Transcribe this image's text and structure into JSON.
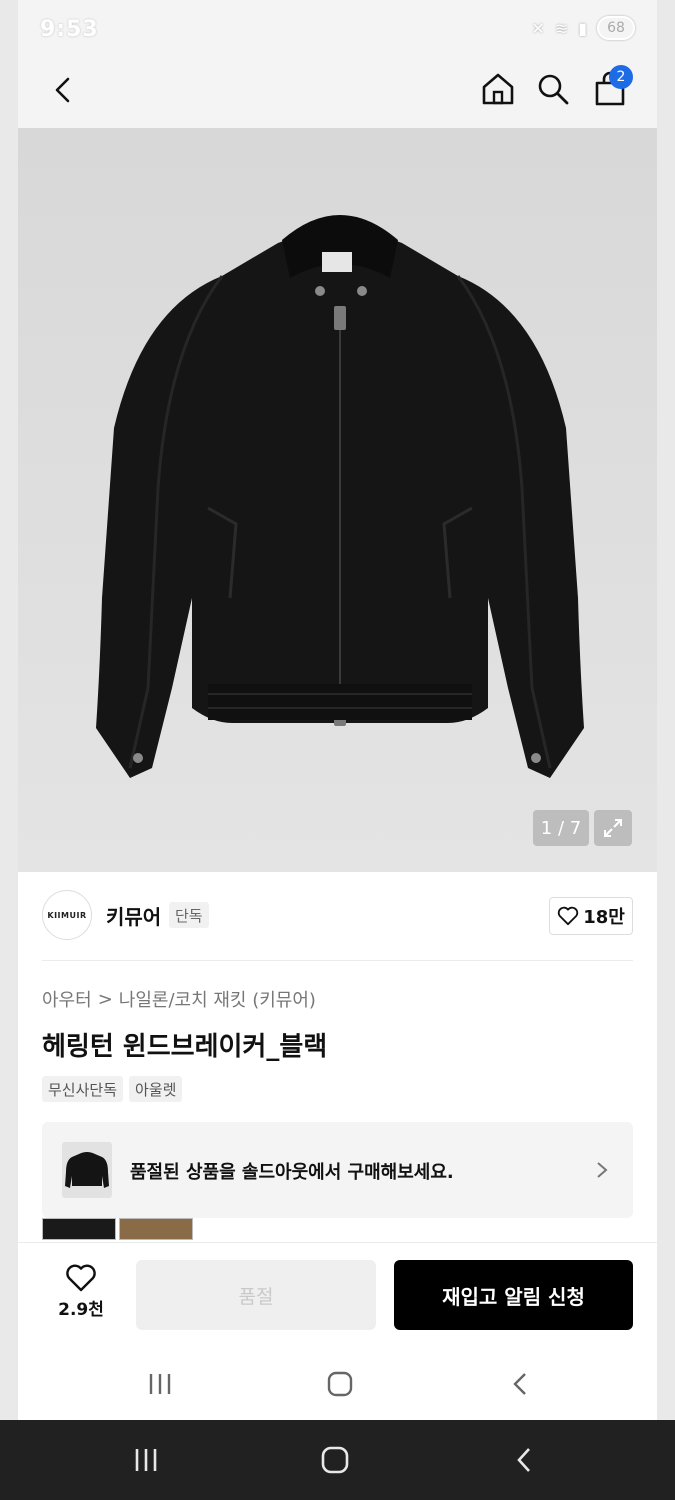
{
  "status_bar": {
    "time": "9:53",
    "battery": "68"
  },
  "header": {
    "cart_count": "2",
    "icons": [
      "back-icon",
      "home-icon",
      "search-icon",
      "cart-icon"
    ]
  },
  "gallery": {
    "counter": "1 / 7"
  },
  "brand": {
    "logo_text": "KIIMUIR",
    "name": "키뮤어",
    "badge": "단독",
    "likes": "18만"
  },
  "product": {
    "breadcrumb": {
      "category": "아우터",
      "separator": ">",
      "subcategory": "나일론/코치 재킷 (키뮤어)"
    },
    "title": "헤링턴 윈드브레이커_블랙",
    "tags": [
      "무신사단독",
      "아울렛"
    ]
  },
  "soldout_banner": {
    "text": "품절된 상품을 솔드아웃에서 구매해보세요."
  },
  "colors": {
    "accent": "#1e6be6",
    "cta_background": "#000000",
    "disabled_text": "#c9c9c9"
  },
  "bottom_bar": {
    "wish_count": "2.9천",
    "soldout_label": "품절",
    "restock_label": "재입고 알림 신청"
  }
}
